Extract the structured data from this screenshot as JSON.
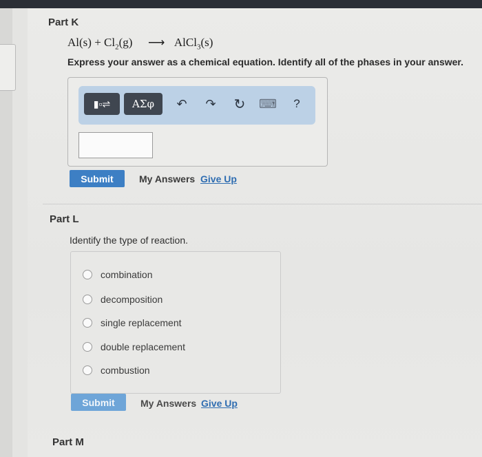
{
  "part_k": {
    "title": "Part K",
    "equation": {
      "reactant1": "Al(s)",
      "plus": "+",
      "reactant2_base": "Cl",
      "reactant2_sub": "2",
      "reactant2_phase": "(g)",
      "arrow": "⟶",
      "product_base": "AlCl",
      "product_sub": "3",
      "product_phase": "(s)"
    },
    "instruction": "Express your answer as a chemical equation. Identify all of the phases in your answer.",
    "toolbar": {
      "template_label": "▮▫⇌",
      "greek_label": "ΑΣφ",
      "undo_icon": "↶",
      "redo_icon": "↷",
      "reset_icon": "↻",
      "keyboard_icon": "⌨",
      "help_label": "?"
    },
    "submit_label": "Submit",
    "my_answers_label": "My Answers",
    "give_up_label": "Give Up"
  },
  "part_l": {
    "title": "Part L",
    "question": "Identify the type of reaction.",
    "options": [
      "combination",
      "decomposition",
      "single replacement",
      "double replacement",
      "combustion"
    ],
    "submit_label": "Submit",
    "my_answers_label": "My Answers",
    "give_up_label": "Give Up"
  },
  "part_m": {
    "title": "Part M"
  },
  "colors": {
    "accent": "#3d7fc4",
    "toolbar_bg": "#bcd1e6",
    "link": "#2f6db1"
  }
}
